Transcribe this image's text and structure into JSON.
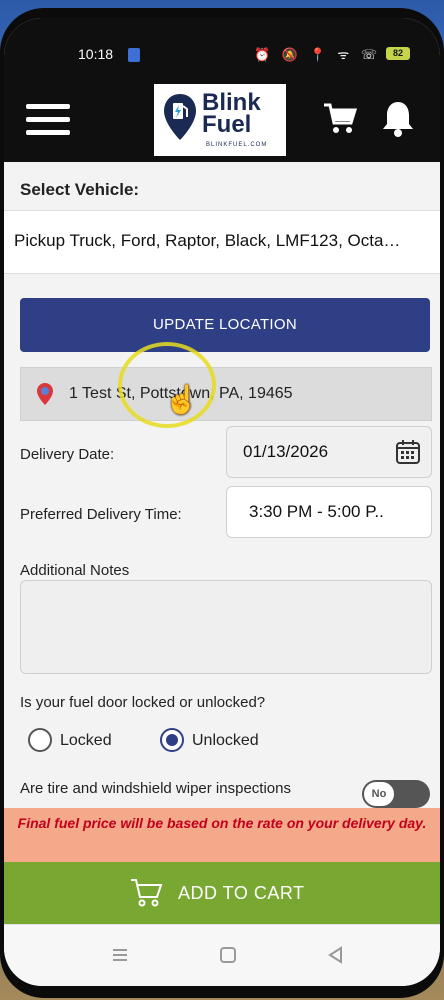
{
  "status_bar": {
    "time": "10:18",
    "icons": "⏰ 🔕 📍 ᯤ ☏ ıl",
    "battery": "82"
  },
  "app_bar": {
    "logo_line1": "Blink",
    "logo_line2": "Fuel",
    "logo_url": "BLINKFUEL.COM"
  },
  "vehicle": {
    "label": "Select Vehicle:",
    "selected": "Pickup Truck, Ford, Raptor, Black, LMF123, Octa…"
  },
  "location": {
    "update_button": "UPDATE LOCATION",
    "address": "1 Test St, Pottstown, PA, 19465"
  },
  "delivery": {
    "date_label": "Delivery Date:",
    "date_value": "01/13/2026",
    "time_label": "Preferred Delivery Time:",
    "time_value": "3:30 PM - 5:00 P.."
  },
  "notes": {
    "label": "Additional Notes",
    "value": ""
  },
  "fuel_door": {
    "question": "Is your fuel door locked or unlocked?",
    "options": [
      "Locked",
      "Unlocked"
    ],
    "selected": "Unlocked"
  },
  "inspection": {
    "question": "Are tire and windshield wiper inspections",
    "toggle_label": "No"
  },
  "notice": "Final fuel price will be based on the rate on your delivery day.",
  "add_to_cart": "ADD TO CART",
  "colors": {
    "primary": "#2f3f86",
    "accent_green": "#79a832",
    "notice_bg": "#f3a98a",
    "notice_text": "#c3001c"
  }
}
